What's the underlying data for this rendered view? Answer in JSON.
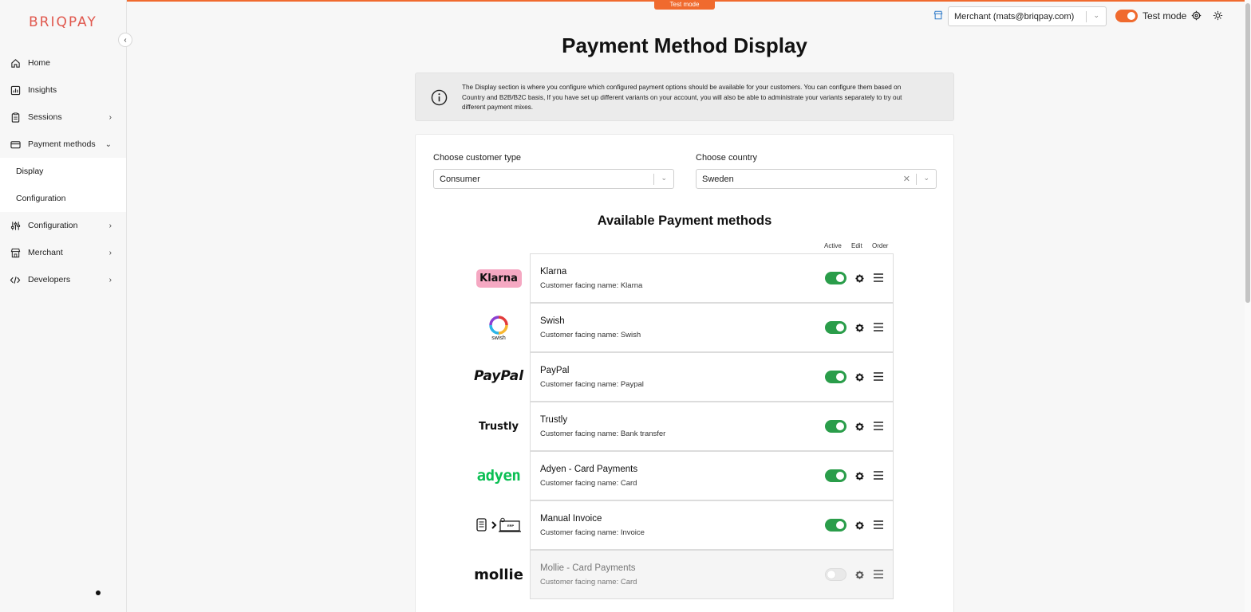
{
  "app": {
    "logo": "BRIQPAY",
    "test_badge": "Test mode"
  },
  "sidebar": {
    "items": [
      {
        "label": "Home",
        "icon": "home-icon"
      },
      {
        "label": "Insights",
        "icon": "chart-icon"
      },
      {
        "label": "Sessions",
        "icon": "clipboard-icon"
      },
      {
        "label": "Payment methods",
        "icon": "card-icon"
      },
      {
        "label": "Configuration",
        "icon": "sliders-icon"
      },
      {
        "label": "Merchant",
        "icon": "store-icon"
      },
      {
        "label": "Developers",
        "icon": "code-icon"
      }
    ],
    "subitems": [
      {
        "label": "Display"
      },
      {
        "label": "Configuration"
      }
    ]
  },
  "topbar": {
    "merchant": "Merchant (mats@briqpay.com)",
    "test_mode_label": "Test mode",
    "test_mode_on": true
  },
  "page": {
    "title": "Payment Method Display",
    "info": "The Display section is where you configure which configured payment options should be available for your customers. You can configure them based on Country and B2B/B2C basis, If you have set up different variants on your account, you will also be able to administrate your variants separately to try out different payment mixes."
  },
  "filters": {
    "customer_type_label": "Choose customer type",
    "customer_type_value": "Consumer",
    "country_label": "Choose country",
    "country_value": "Sweden"
  },
  "methods": {
    "title": "Available Payment methods",
    "col_active": "Active",
    "col_edit": "Edit",
    "col_order": "Order",
    "rows": [
      {
        "name": "Klarna",
        "subtitle": "Customer facing name: Klarna",
        "active": true,
        "logo_text": "Klarna"
      },
      {
        "name": "Swish",
        "subtitle": "Customer facing name: Swish",
        "active": true,
        "logo_text": "swish"
      },
      {
        "name": "PayPal",
        "subtitle": "Customer facing name: Paypal",
        "active": true,
        "logo_text": "PayPal"
      },
      {
        "name": "Trustly",
        "subtitle": "Customer facing name: Bank transfer",
        "active": true,
        "logo_text": "Trustly"
      },
      {
        "name": "Adyen - Card Payments",
        "subtitle": "Customer facing name: Card",
        "active": true,
        "logo_text": "adyen"
      },
      {
        "name": "Manual Invoice",
        "subtitle": "Customer facing name: Invoice",
        "active": true,
        "logo_text": "ERP"
      },
      {
        "name": "Mollie - Card Payments",
        "subtitle": "Customer facing name: Card",
        "active": false,
        "logo_text": "mollie"
      }
    ]
  },
  "colors": {
    "accent": "#f06a2e",
    "active_green": "#2a9d4a",
    "brand": "#e0584e",
    "klarna_pink": "#f5a8c2",
    "adyen_green": "#0abf53"
  }
}
